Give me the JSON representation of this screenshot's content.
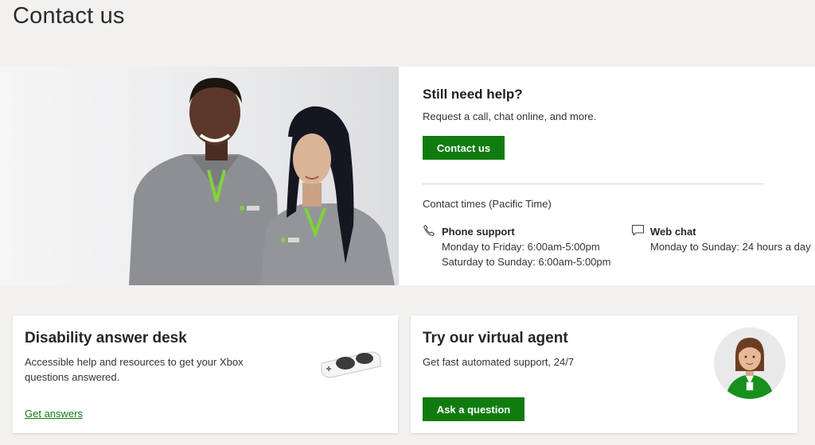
{
  "page": {
    "title": "Contact us"
  },
  "hero": {
    "title": "Still need help?",
    "subtitle": "Request a call, chat online, and more.",
    "contact_button": "Contact us",
    "times_title": "Contact times (Pacific Time)",
    "phone": {
      "icon": "phone-icon",
      "label": "Phone support",
      "line1": "Monday to Friday: 6:00am-5:00pm",
      "line2": "Saturday to Sunday: 6:00am-5:00pm"
    },
    "chat": {
      "icon": "chat-icon",
      "label": "Web chat",
      "line1": "Monday to Sunday: 24 hours a day"
    }
  },
  "cards": {
    "disability": {
      "title": "Disability answer desk",
      "text": "Accessible help and resources to get your Xbox questions answered.",
      "link": "Get answers"
    },
    "agent": {
      "title": "Try our virtual agent",
      "text": "Get fast automated support, 24/7",
      "button": "Ask a question"
    }
  },
  "colors": {
    "accent": "#107c10",
    "background": "#f2f1f0",
    "card": "#ffffff"
  }
}
